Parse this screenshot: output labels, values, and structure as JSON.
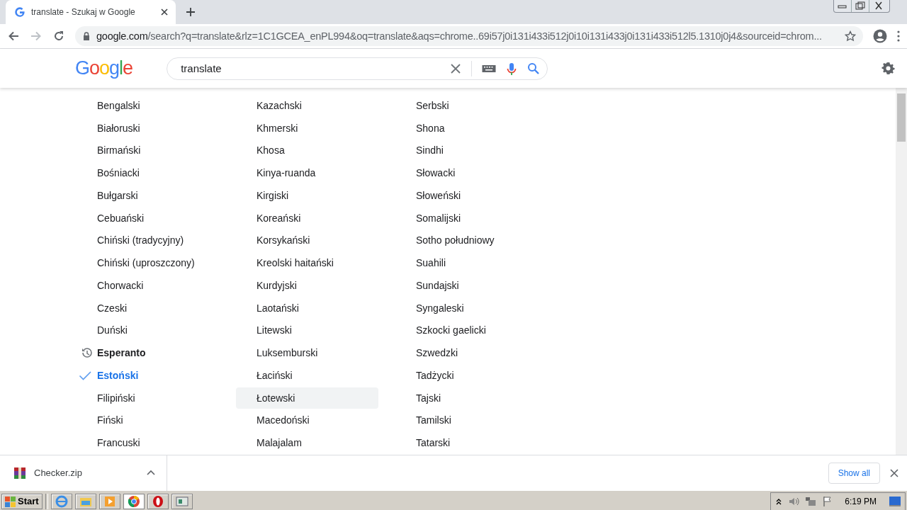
{
  "tab": {
    "title": "translate - Szukaj w Google",
    "selected": true
  },
  "address": {
    "domain": "google.com",
    "path": "/search?q=translate&rlz=1C1GCEA_enPL994&oq=translate&aqs=chrome..69i57j0i131i433i512j0i10i131i433j0i131i433i512l5.1310j0j4&sourceid=chrom..."
  },
  "logo": "Google",
  "search": {
    "value": "translate"
  },
  "languages": [
    [
      {
        "label": "Bengalski",
        "kind": "plain",
        "selected": false,
        "hovered": false
      },
      {
        "label": "Białoruski",
        "kind": "plain",
        "selected": false,
        "hovered": false
      },
      {
        "label": "Birmański",
        "kind": "plain",
        "selected": false,
        "hovered": false
      },
      {
        "label": "Bośniacki",
        "kind": "plain",
        "selected": false,
        "hovered": false
      },
      {
        "label": "Bułgarski",
        "kind": "plain",
        "selected": false,
        "hovered": false
      },
      {
        "label": "Cebuański",
        "kind": "plain",
        "selected": false,
        "hovered": false
      },
      {
        "label": "Chiński (tradycyjny)",
        "kind": "plain",
        "selected": false,
        "hovered": false
      },
      {
        "label": "Chiński (uproszczony)",
        "kind": "plain",
        "selected": false,
        "hovered": false
      },
      {
        "label": "Chorwacki",
        "kind": "plain",
        "selected": false,
        "hovered": false
      },
      {
        "label": "Czeski",
        "kind": "plain",
        "selected": false,
        "hovered": false
      },
      {
        "label": "Duński",
        "kind": "plain",
        "selected": false,
        "hovered": false
      },
      {
        "label": "Esperanto",
        "kind": "recent",
        "selected": false,
        "hovered": false
      },
      {
        "label": "Estoński",
        "kind": "plain",
        "selected": true,
        "hovered": false
      },
      {
        "label": "Filipiński",
        "kind": "plain",
        "selected": false,
        "hovered": false
      },
      {
        "label": "Fiński",
        "kind": "plain",
        "selected": false,
        "hovered": false
      },
      {
        "label": "Francuski",
        "kind": "plain",
        "selected": false,
        "hovered": false
      }
    ],
    [
      {
        "label": "Kazachski",
        "kind": "plain",
        "selected": false,
        "hovered": false
      },
      {
        "label": "Khmerski",
        "kind": "plain",
        "selected": false,
        "hovered": false
      },
      {
        "label": "Khosa",
        "kind": "plain",
        "selected": false,
        "hovered": false
      },
      {
        "label": "Kinya-ruanda",
        "kind": "plain",
        "selected": false,
        "hovered": false
      },
      {
        "label": "Kirgiski",
        "kind": "plain",
        "selected": false,
        "hovered": false
      },
      {
        "label": "Koreański",
        "kind": "plain",
        "selected": false,
        "hovered": false
      },
      {
        "label": "Korsykański",
        "kind": "plain",
        "selected": false,
        "hovered": false
      },
      {
        "label": "Kreolski haitański",
        "kind": "plain",
        "selected": false,
        "hovered": false
      },
      {
        "label": "Kurdyjski",
        "kind": "plain",
        "selected": false,
        "hovered": false
      },
      {
        "label": "Laotański",
        "kind": "plain",
        "selected": false,
        "hovered": false
      },
      {
        "label": "Litewski",
        "kind": "plain",
        "selected": false,
        "hovered": false
      },
      {
        "label": "Luksemburski",
        "kind": "plain",
        "selected": false,
        "hovered": false
      },
      {
        "label": "Łaciński",
        "kind": "plain",
        "selected": false,
        "hovered": false
      },
      {
        "label": "Łotewski",
        "kind": "plain",
        "selected": false,
        "hovered": true
      },
      {
        "label": "Macedoński",
        "kind": "plain",
        "selected": false,
        "hovered": false
      },
      {
        "label": "Malajalam",
        "kind": "plain",
        "selected": false,
        "hovered": false
      }
    ],
    [
      {
        "label": "Serbski",
        "kind": "plain",
        "selected": false,
        "hovered": false
      },
      {
        "label": "Shona",
        "kind": "plain",
        "selected": false,
        "hovered": false
      },
      {
        "label": "Sindhi",
        "kind": "plain",
        "selected": false,
        "hovered": false
      },
      {
        "label": "Słowacki",
        "kind": "plain",
        "selected": false,
        "hovered": false
      },
      {
        "label": "Słoweński",
        "kind": "plain",
        "selected": false,
        "hovered": false
      },
      {
        "label": "Somalijski",
        "kind": "plain",
        "selected": false,
        "hovered": false
      },
      {
        "label": "Sotho południowy",
        "kind": "plain",
        "selected": false,
        "hovered": false
      },
      {
        "label": "Suahili",
        "kind": "plain",
        "selected": false,
        "hovered": false
      },
      {
        "label": "Sundajski",
        "kind": "plain",
        "selected": false,
        "hovered": false
      },
      {
        "label": "Syngaleski",
        "kind": "plain",
        "selected": false,
        "hovered": false
      },
      {
        "label": "Szkocki gaelicki",
        "kind": "plain",
        "selected": false,
        "hovered": false
      },
      {
        "label": "Szwedzki",
        "kind": "plain",
        "selected": false,
        "hovered": false
      },
      {
        "label": "Tadżycki",
        "kind": "plain",
        "selected": false,
        "hovered": false
      },
      {
        "label": "Tajski",
        "kind": "plain",
        "selected": false,
        "hovered": false
      },
      {
        "label": "Tamilski",
        "kind": "plain",
        "selected": false,
        "hovered": false
      },
      {
        "label": "Tatarski",
        "kind": "plain",
        "selected": false,
        "hovered": false
      }
    ]
  ],
  "download": {
    "filename": "Checker.zip",
    "show_all": "Show all"
  },
  "taskbar": {
    "start": "Start",
    "clock": "6:19 PM"
  }
}
